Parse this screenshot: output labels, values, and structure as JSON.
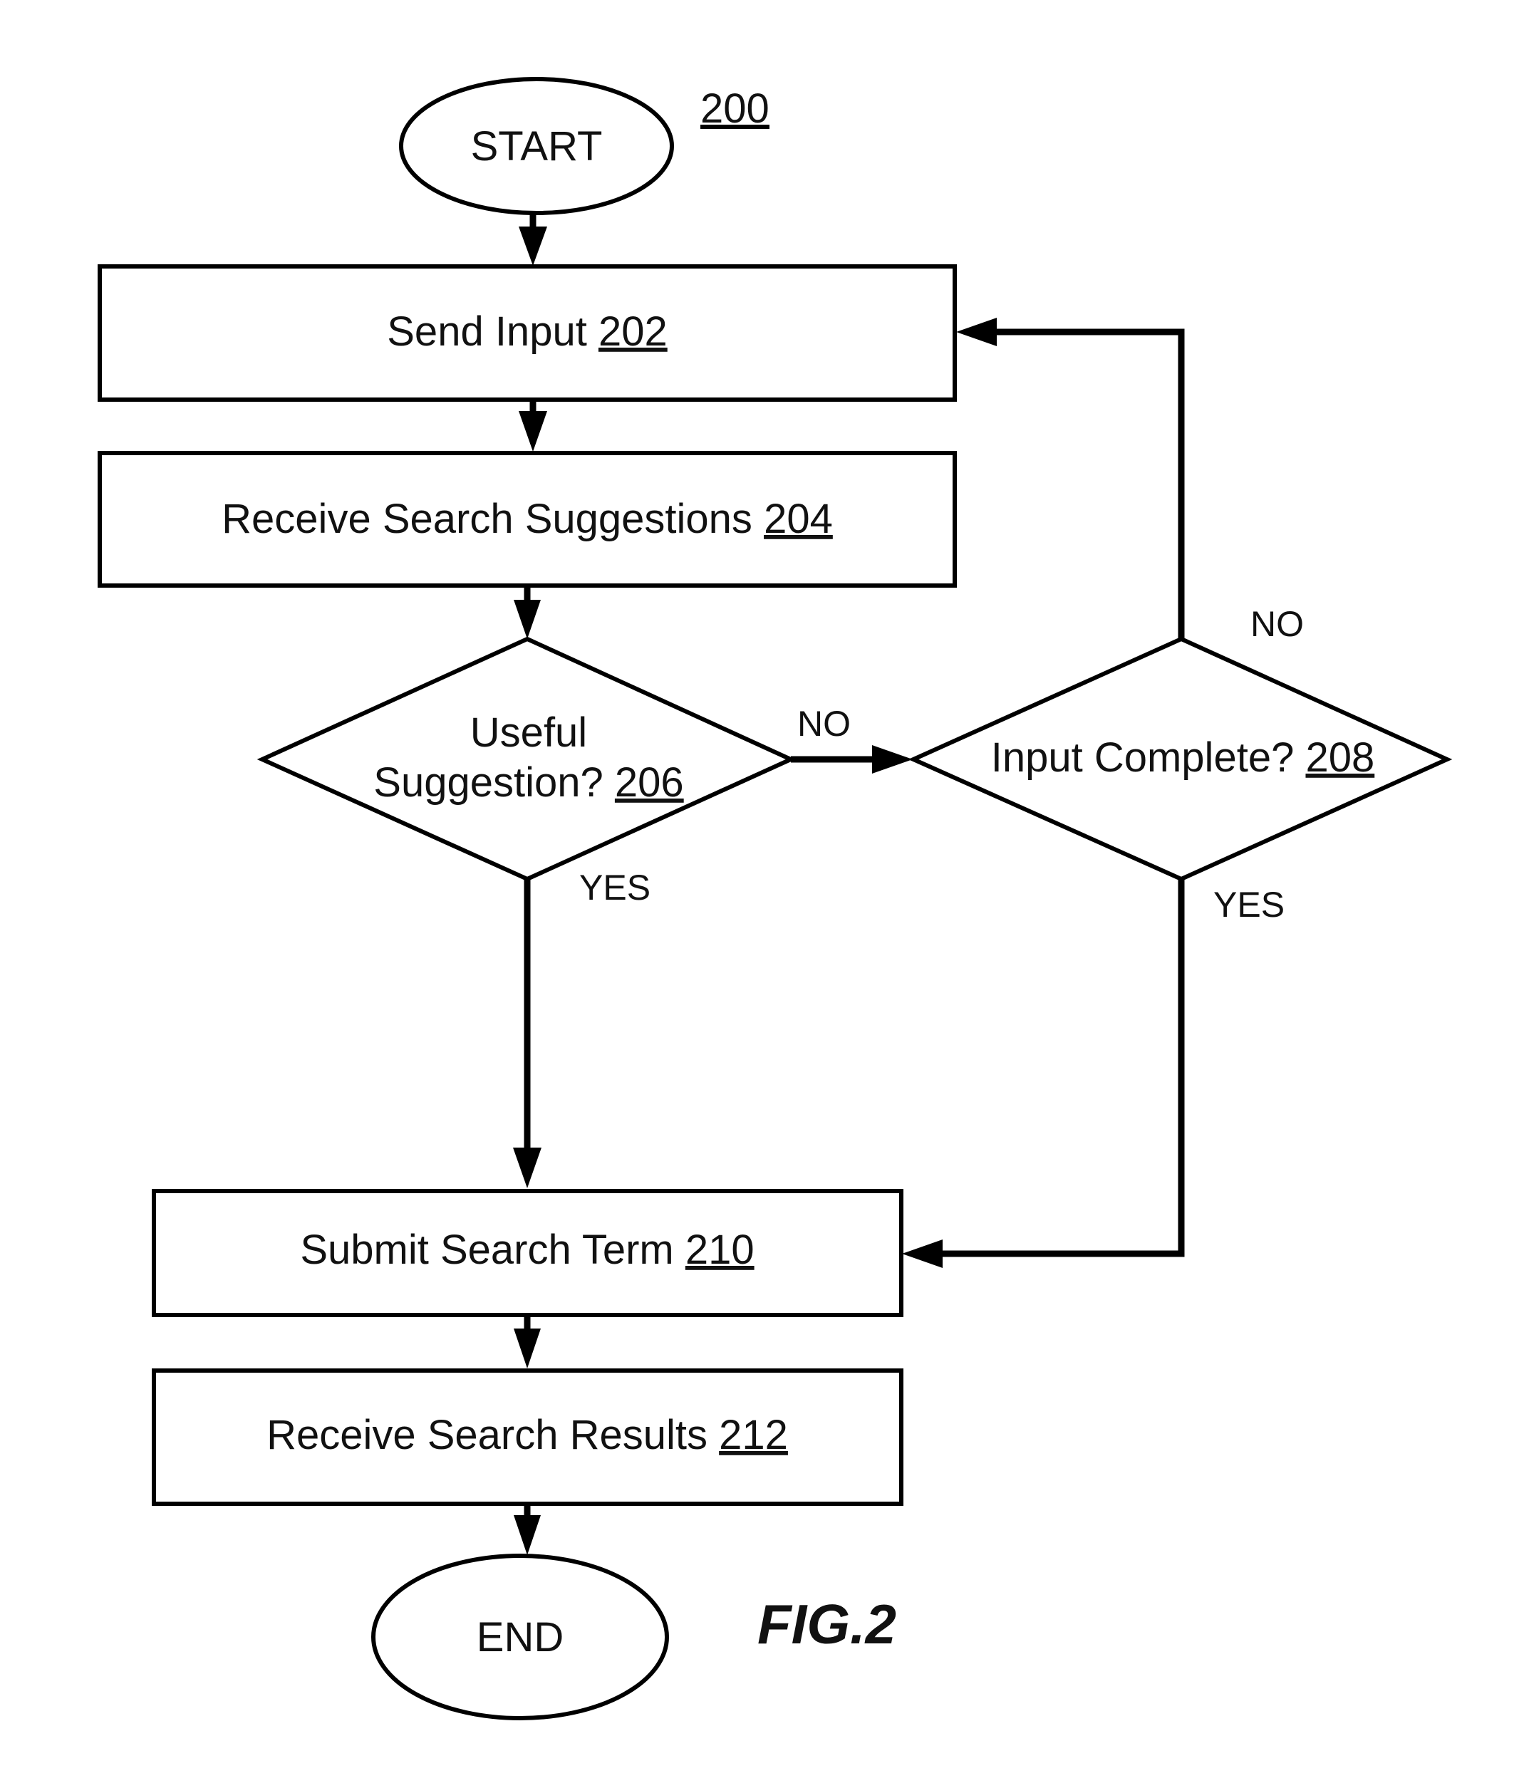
{
  "figure": {
    "reference_number": "200",
    "caption": "FIG.2"
  },
  "nodes": {
    "start": {
      "label": "START"
    },
    "send_input": {
      "label": "Send Input",
      "ref": "202"
    },
    "receive_suggestions": {
      "label": "Receive Search Suggestions",
      "ref": "204"
    },
    "useful_suggestion": {
      "label_line1": "Useful",
      "label_line2": "Suggestion?",
      "ref": "206"
    },
    "input_complete": {
      "label": "Input Complete?",
      "ref": "208"
    },
    "submit_term": {
      "label": "Submit Search Term",
      "ref": "210"
    },
    "receive_results": {
      "label": "Receive Search Results",
      "ref": "212"
    },
    "end": {
      "label": "END"
    }
  },
  "edges": [
    {
      "from": "start",
      "to": "send_input",
      "label": ""
    },
    {
      "from": "send_input",
      "to": "receive_suggestions",
      "label": ""
    },
    {
      "from": "receive_suggestions",
      "to": "useful_suggestion",
      "label": ""
    },
    {
      "from": "useful_suggestion",
      "to": "input_complete",
      "label": "NO"
    },
    {
      "from": "useful_suggestion",
      "to": "submit_term",
      "label": "YES"
    },
    {
      "from": "input_complete",
      "to": "send_input",
      "label": "NO"
    },
    {
      "from": "input_complete",
      "to": "submit_term",
      "label": "YES"
    },
    {
      "from": "submit_term",
      "to": "receive_results",
      "label": ""
    },
    {
      "from": "receive_results",
      "to": "end",
      "label": ""
    }
  ],
  "branch_labels": {
    "useful_no": "NO",
    "useful_yes": "YES",
    "complete_no": "NO",
    "complete_yes": "YES"
  }
}
